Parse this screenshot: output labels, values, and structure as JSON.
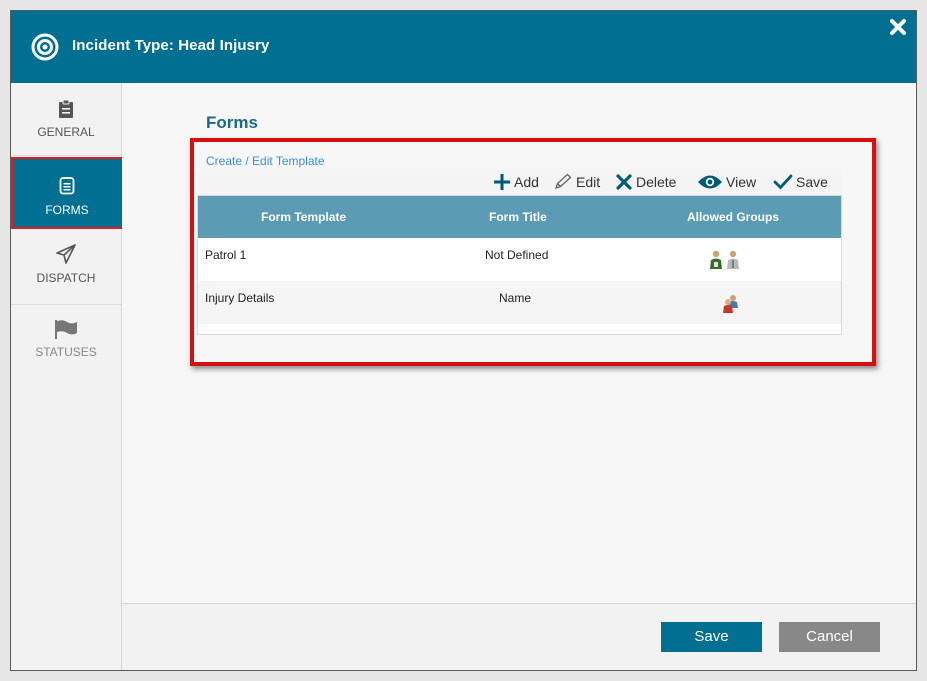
{
  "dialog": {
    "title": "Incident Type: Head Injusry",
    "close_icon": "close-icon"
  },
  "sidebar": {
    "items": [
      {
        "label": "GENERAL",
        "icon": "clipboard-icon",
        "active": false
      },
      {
        "label": "FORMS",
        "icon": "notepad-icon",
        "active": true
      },
      {
        "label": "DISPATCH",
        "icon": "paper-plane-icon",
        "active": false
      },
      {
        "label": "STATUSES",
        "icon": "flag-icon",
        "active": false
      }
    ]
  },
  "forms": {
    "title": "Forms",
    "create_link": "Create / Edit Template",
    "toolbar": {
      "add": "Add",
      "edit": "Edit",
      "delete": "Delete",
      "view": "View",
      "save": "Save"
    },
    "columns": [
      "Form Template",
      "Form Title",
      "Allowed Groups"
    ],
    "rows": [
      {
        "template": "Patrol 1",
        "title": "Not Defined",
        "groups_icons": [
          "green-user-icon",
          "grey-user-icon"
        ]
      },
      {
        "template": "Injury Details",
        "title": "Name",
        "groups_icons": [
          "group-users-icon"
        ]
      }
    ]
  },
  "footer": {
    "save": "Save",
    "cancel": "Cancel"
  },
  "colors": {
    "header": "#006f91",
    "grid_header": "#5b9bb4",
    "highlight_border": "#d51010",
    "cancel_button": "#888888"
  }
}
